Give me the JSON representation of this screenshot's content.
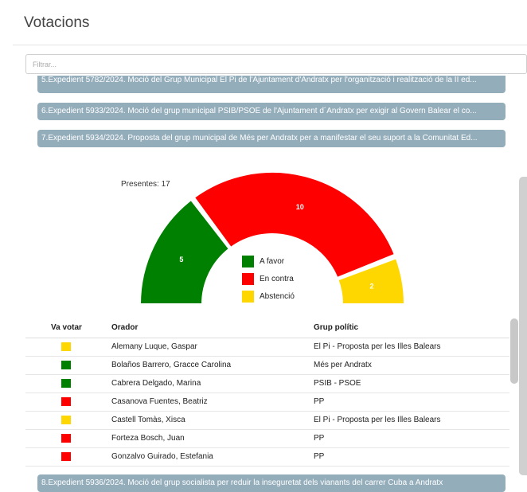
{
  "header": {
    "title": "Votacions"
  },
  "filter": {
    "placeholder": "Filtrar..."
  },
  "expedients": {
    "clipped": "5.Expedient 5782/2024. Moció del Grup Municipal El Pi de l'Ajuntament d'Andratx per l'organització i realització de la II ed...",
    "item6": "6.Expedient 5933/2024. Moció del grup municipal PSIB/PSOE de l'Ajuntament d´Andratx per exigir al Govern Balear el co...",
    "item7": "7.Expedient 5934/2024. Proposta del grup municipal de Més per Andratx per a manifestar el seu suport a la Comunitat Ed...",
    "item8": "8.Expedient 5936/2024. Moció del grup socialista per reduir la inseguretat dels vianants del carrer Cuba a Andratx"
  },
  "chart_data": {
    "type": "pie",
    "variant": "half-donut",
    "presentes_label": "Presentes: 17",
    "slices": [
      {
        "name": "A favor",
        "value": 5,
        "color": "#008000",
        "label": "5"
      },
      {
        "name": "En contra",
        "value": 10,
        "color": "#ff0000",
        "label": "10"
      },
      {
        "name": "Abstenció",
        "value": 2,
        "color": "#ffd700",
        "label": "2"
      }
    ]
  },
  "table": {
    "headers": {
      "vote": "Va votar",
      "orador": "Orador",
      "grup": "Grup polític"
    },
    "rows": [
      {
        "vote_color": "#ffd700",
        "orador": "Alemany Luque, Gaspar",
        "grup": "El Pi - Proposta per les Illes Balears"
      },
      {
        "vote_color": "#008000",
        "orador": "Bolaños Barrero, Gracce Carolina",
        "grup": "Més per Andratx"
      },
      {
        "vote_color": "#008000",
        "orador": "Cabrera Delgado, Marina",
        "grup": "PSIB - PSOE"
      },
      {
        "vote_color": "#ff0000",
        "orador": "Casanova Fuentes, Beatriz",
        "grup": "PP"
      },
      {
        "vote_color": "#ffd700",
        "orador": "Castell Tomàs, Xisca",
        "grup": "El Pi - Proposta per les Illes Balears"
      },
      {
        "vote_color": "#ff0000",
        "orador": "Forteza Bosch, Juan",
        "grup": "PP"
      },
      {
        "vote_color": "#ff0000",
        "orador": "Gonzalvo Guirado, Estefania",
        "grup": "PP"
      }
    ]
  }
}
